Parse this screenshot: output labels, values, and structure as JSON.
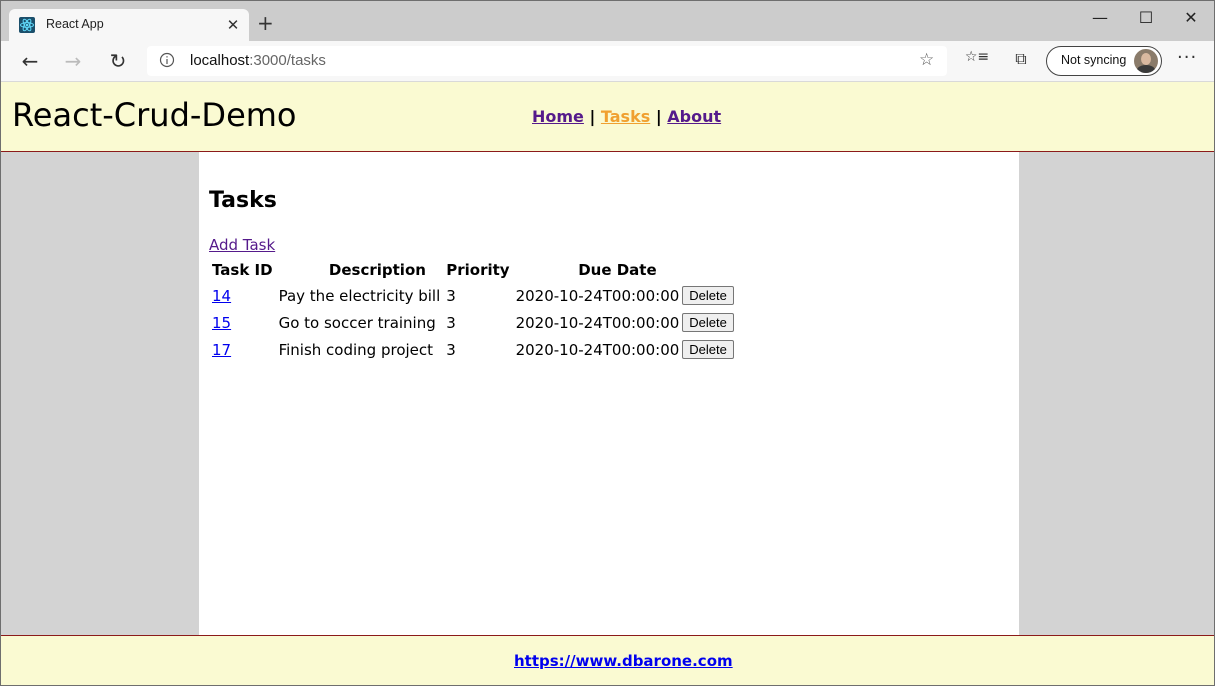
{
  "browser": {
    "tab_title": "React App",
    "tab_close": "✕",
    "new_tab": "+",
    "url_host": "localhost",
    "url_path": ":3000/tasks",
    "sync_label": "Not syncing",
    "window_controls": {
      "minimize": "—",
      "maximize": "☐",
      "close": "✕"
    },
    "icons": {
      "back": "←",
      "forward": "→",
      "reload": "↻",
      "favorite": "☆",
      "favorites_list": "☆≡",
      "collections": "⧉",
      "more": "···"
    }
  },
  "app": {
    "brand": "React-Crud-Demo",
    "nav": {
      "home": "Home",
      "tasks": "Tasks",
      "about": "About",
      "separator": "|",
      "active": "tasks"
    },
    "page_title": "Tasks",
    "add_task_label": "Add Task",
    "table": {
      "headers": [
        "Task ID",
        "Description",
        "Priority",
        "Due Date"
      ],
      "rows": [
        {
          "id": "14",
          "description": "Pay the electricity bill",
          "priority": "3",
          "due_date": "2020-10-24T00:00:00",
          "action": "Delete"
        },
        {
          "id": "15",
          "description": "Go to soccer training",
          "priority": "3",
          "due_date": "2020-10-24T00:00:00",
          "action": "Delete"
        },
        {
          "id": "17",
          "description": "Finish coding project",
          "priority": "3",
          "due_date": "2020-10-24T00:00:00",
          "action": "Delete"
        }
      ]
    },
    "footer_link": "https://www.dbarone.com"
  },
  "colors": {
    "header_bg": "#fafad2",
    "border_accent": "#8b1a1a",
    "nav_link": "#551a8b",
    "nav_active": "#f0a030",
    "link": "#0000ee",
    "side_bg": "#d3d3d3"
  }
}
